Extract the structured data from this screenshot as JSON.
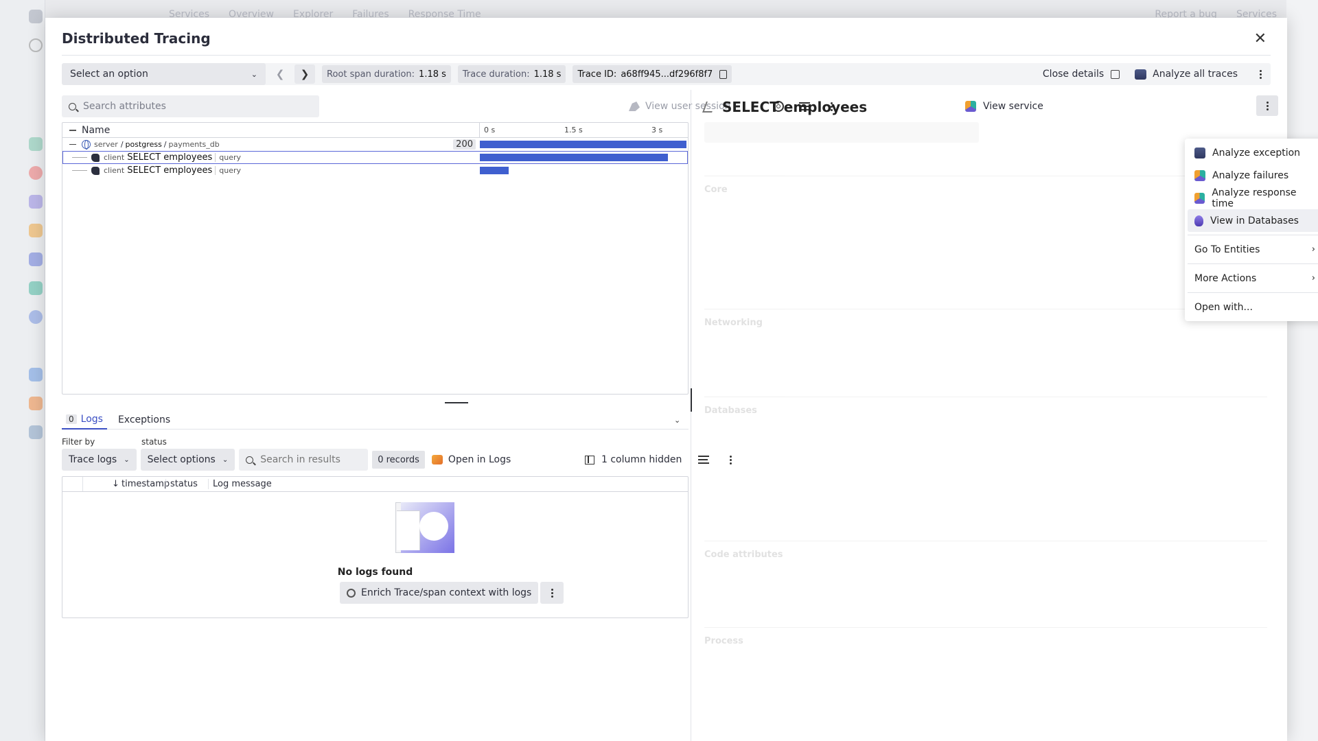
{
  "background": {
    "nav_items": [
      "Services",
      "Overview",
      "Explorer",
      "Failures",
      "Response Time"
    ],
    "right_items": [
      "Report a bug",
      "Services"
    ]
  },
  "modal": {
    "title": "Distributed Tracing",
    "toolbar": {
      "select_placeholder": "Select an option",
      "root_span_label": "Root span duration:",
      "root_span_value": "1.18 s",
      "trace_duration_label": "Trace duration:",
      "trace_duration_value": "1.18 s",
      "trace_id_label": "Trace ID:",
      "trace_id_value": "a68ff945...df296f8f7",
      "close_details": "Close details",
      "analyze_all": "Analyze all traces"
    },
    "left": {
      "search_placeholder": "Search attributes",
      "view_user_session": "View user session",
      "table": {
        "name_header": "Name",
        "ticks": [
          "0 s",
          "1.5 s",
          "3 s"
        ],
        "rows": [
          {
            "kind": "server",
            "service": "postgress",
            "db": "payments_db",
            "status": "200",
            "bar_fraction": 1.0
          },
          {
            "kind": "client",
            "name": "SELECT employees",
            "tag": "query",
            "bar_fraction": 0.91
          },
          {
            "kind": "client",
            "name": "SELECT employees",
            "tag": "query",
            "bar_fraction": 0.14
          }
        ]
      }
    },
    "logs": {
      "tab_logs_count": "0",
      "tab_logs": "Logs",
      "tab_exceptions": "Exceptions",
      "filter_by_label": "Filter by",
      "status_label": "status",
      "trace_logs": "Trace logs",
      "select_options": "Select options",
      "search_placeholder": "Search in results",
      "records": "0 records",
      "open_in_logs": "Open in Logs",
      "column_hidden": "1 column hidden",
      "columns": [
        "timestamp",
        "status",
        "Log message"
      ],
      "empty_text": "No logs found",
      "enrich": "Enrich Trace/span context with logs"
    },
    "right": {
      "title": "SELECT employees",
      "view_service": "View service",
      "ghost": {
        "search": "Search attributes",
        "sections": [
          "Core",
          "Networking",
          "Databases",
          "Code attributes",
          "Process"
        ]
      }
    },
    "menu": {
      "items": [
        "Analyze exception",
        "Analyze failures",
        "Analyze response time",
        "View in Databases"
      ],
      "go_to": "Go To Entities",
      "more": "More Actions",
      "open_with": "Open with..."
    }
  },
  "colors": {
    "accent": "#3b4fc4",
    "bar": "#3f5fcf"
  }
}
